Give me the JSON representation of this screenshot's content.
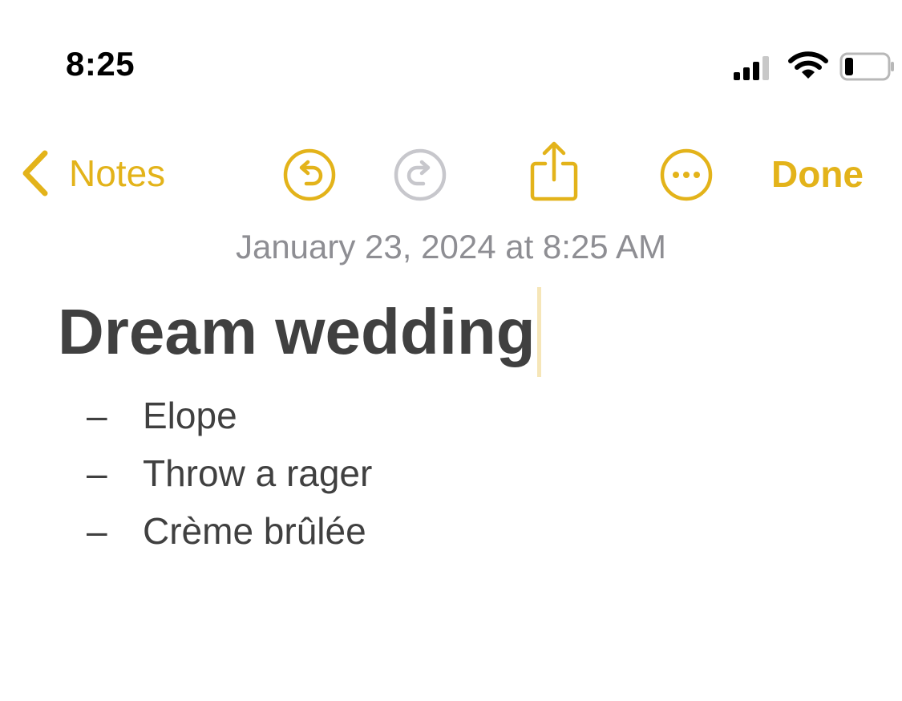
{
  "status_bar": {
    "time": "8:25",
    "icons": [
      "cellular-signal-icon",
      "wifi-icon",
      "battery-icon"
    ]
  },
  "toolbar": {
    "back_label": "Notes",
    "done_label": "Done",
    "icons": [
      "chevron-left-icon",
      "undo-icon",
      "redo-icon",
      "share-icon",
      "more-icon"
    ]
  },
  "note": {
    "date": "January 23, 2024 at 8:25 AM",
    "title": "Dream wedding",
    "items": [
      {
        "bullet": "–",
        "text": "Elope"
      },
      {
        "bullet": "–",
        "text": "Throw a rager"
      },
      {
        "bullet": "–",
        "text": "Crème brûlée"
      }
    ]
  },
  "colors": {
    "accent": "#E3B31A",
    "disabled": "#C7C7CC",
    "date_text": "#8E8E93",
    "body_text": "#404040",
    "caret": "#F6E6B8"
  }
}
